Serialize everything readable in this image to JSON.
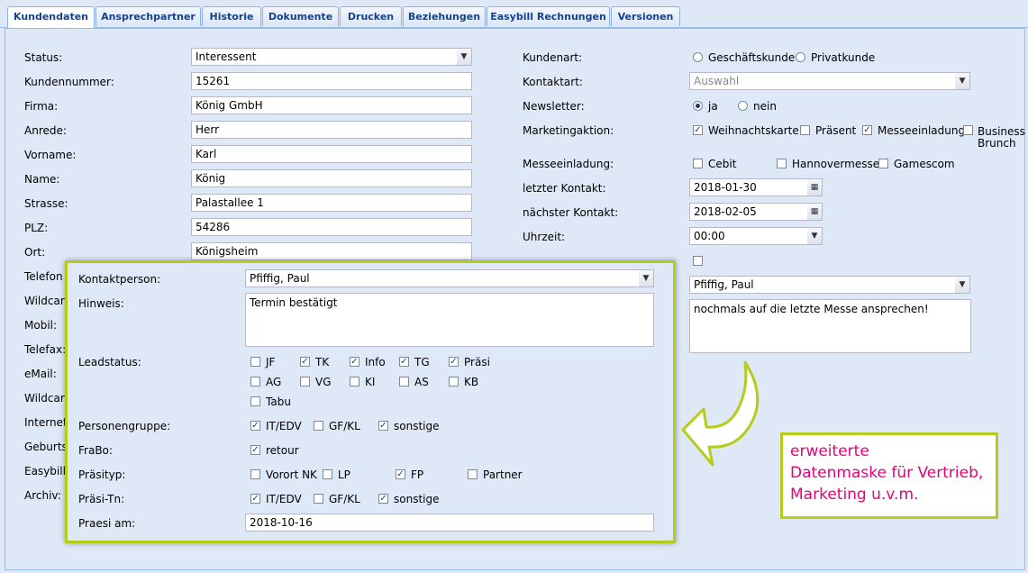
{
  "tabs": [
    "Kundendaten",
    "Ansprechpartner",
    "Historie",
    "Dokumente",
    "Drucken",
    "Beziehungen",
    "Easybill Rechnungen",
    "Versionen"
  ],
  "left": {
    "status_label": "Status:",
    "status_value": "Interessent",
    "kundennummer_label": "Kundennummer:",
    "kundennummer_value": "15261",
    "firma_label": "Firma:",
    "firma_value": "König GmbH",
    "anrede_label": "Anrede:",
    "anrede_value": "Herr",
    "vorname_label": "Vorname:",
    "vorname_value": "Karl",
    "name_label": "Name:",
    "name_value": "König",
    "strasse_label": "Strasse:",
    "strasse_value": "Palastallee 1",
    "plz_label": "PLZ:",
    "plz_value": "54286",
    "ort_label": "Ort:",
    "ort_value": "Königsheim",
    "telefon_label": "Telefon",
    "wildcard1_label": "Wildcard",
    "mobil_label": "Mobil:",
    "telefax_label": "Telefax:",
    "email_label": "eMail:",
    "wildcard2_label": "Wildcard",
    "internet_label": "Internet",
    "geburts_label": "Geburts",
    "easybill_label": "EasybillI",
    "archiv_label": "Archiv:"
  },
  "right": {
    "kundenart_label": "Kundenart:",
    "geschaeftskunde": "Geschäftskunde",
    "privatkunde": "Privatkunde",
    "kontaktart_label": "Kontaktart:",
    "kontaktart_placeholder": "Auswahl",
    "newsletter_label": "Newsletter:",
    "ja": "ja",
    "nein": "nein",
    "marketing_label": "Marketingaktion:",
    "weihnachtskarte": "Weihnachtskarte",
    "praesent": "Präsent",
    "messeeinladung": "Messeeinladung",
    "business": "Business",
    "brunch": "Brunch",
    "messe_label": "Messeeinladung:",
    "cebit": "Cebit",
    "hannovermesse": "Hannovermesse",
    "gamescom": "Gamescom",
    "letzter_label": "letzter Kontakt:",
    "letzter_value": "2018-01-30",
    "naechster_label": "nächster Kontakt:",
    "naechster_value": "2018-02-05",
    "uhrzeit_label": "Uhrzeit:",
    "uhrzeit_value": "00:00",
    "person_value": "Pfiffig, Paul",
    "hinweis_value": "nochmals auf die letzte Messe ansprechen!"
  },
  "popup": {
    "kontakt_label": "Kontaktperson:",
    "kontakt_value": "Pfiffig, Paul",
    "hinweis_label": "Hinweis:",
    "hinweis_value": "Termin bestätigt",
    "leadstatus_label": "Leadstatus:",
    "lead_row1": [
      "JF",
      "TK",
      "Info",
      "TG",
      "Präsi"
    ],
    "lead_row2": [
      "AG",
      "VG",
      "KI",
      "AS",
      "KB"
    ],
    "lead_row3": [
      "Tabu"
    ],
    "personengruppe_label": "Personengruppe:",
    "it_edv": "IT/EDV",
    "gf_kl": "GF/KL",
    "sonstige": "sonstige",
    "frabo_label": "FraBo:",
    "retour": "retour",
    "praesityp_label": "Präsityp:",
    "vorort": "Vorort NK",
    "lp": "LP",
    "fp": "FP",
    "partner": "Partner",
    "praesitn_label": "Präsi-Tn:",
    "praesiam_label": "Praesi am:",
    "praesiam_value": "2018-10-16"
  },
  "callout": {
    "line1": "erweiterte",
    "line2": "Datenmaske für Vertrieb,",
    "line3": "Marketing u.v.m."
  },
  "colors": {
    "accent": "#b5cc1a",
    "callout_text": "#e5007d",
    "tab_text": "#15428b"
  }
}
